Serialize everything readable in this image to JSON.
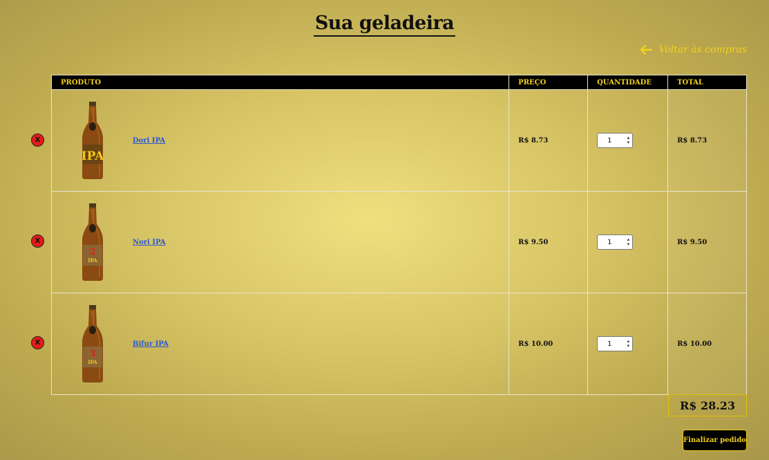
{
  "page": {
    "title": "Sua geladeira"
  },
  "nav": {
    "back_label": "Voltar às compras"
  },
  "table": {
    "headers": {
      "product": "PRODUTO",
      "price": "PREÇO",
      "quantity": "QUANTIDADE",
      "total": "TOTAL"
    },
    "rows": [
      {
        "name": "Dori IPA",
        "price": "R$ 8.73",
        "quantity": "1",
        "total": "R$ 8.73",
        "label_text": "IPA",
        "label_number": "",
        "remove_label": "X"
      },
      {
        "name": "Nori IPA",
        "price": "R$ 9.50",
        "quantity": "1",
        "total": "R$ 9.50",
        "label_text": "IPA",
        "label_number": "2",
        "remove_label": "X"
      },
      {
        "name": "Bifur IPA",
        "price": "R$ 10.00",
        "quantity": "1",
        "total": "R$ 10.00",
        "label_text": "IPA",
        "label_number": "3",
        "remove_label": "X"
      }
    ]
  },
  "summary": {
    "grand_total": "R$ 28.23"
  },
  "actions": {
    "finish_label": "Finalizar pedido"
  },
  "colors": {
    "accent": "#f4d11a",
    "header_bg": "#000000",
    "link": "#2a57d6",
    "remove": "#e41b17"
  }
}
